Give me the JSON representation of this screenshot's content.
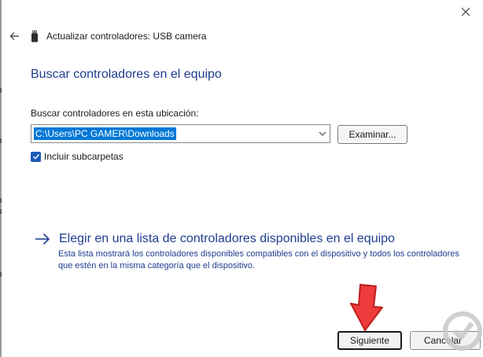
{
  "window": {
    "title": "Actualizar controladores: USB camera"
  },
  "icons": {
    "back": "back-arrow-icon",
    "device": "usb-device-icon",
    "close": "close-icon",
    "combo_arrow": "chevron-down-icon",
    "checkbox": "checkmark-icon",
    "link_arrow": "right-arrow-icon",
    "annotation_arrow": "red-down-arrow",
    "watermark": "site-logo"
  },
  "main": {
    "heading": "Buscar controladores en el equipo",
    "location_label": "Buscar controladores en esta ubicación:",
    "location_value": "C:\\Users\\PC GAMER\\Downloads",
    "browse_button": "Examinar...",
    "include_subfolders_label": "Incluir subcarpetas",
    "include_subfolders_checked": true,
    "list_link_title": "Elegir en una lista de controladores disponibles en el equipo",
    "list_link_description": "Esta lista mostrará los controladores disponibles compatibles con el dispositivo y todos los controladores que estén en la misma categoría que el dispositivo."
  },
  "footer": {
    "next_button": "Siguiente",
    "cancel_button": "Cancelar"
  },
  "colors": {
    "accent_blue": "#1e3d8f",
    "selection": "#0078d7",
    "checkbox": "#1e5bb8",
    "annotation_red": "#ee3b3b"
  }
}
